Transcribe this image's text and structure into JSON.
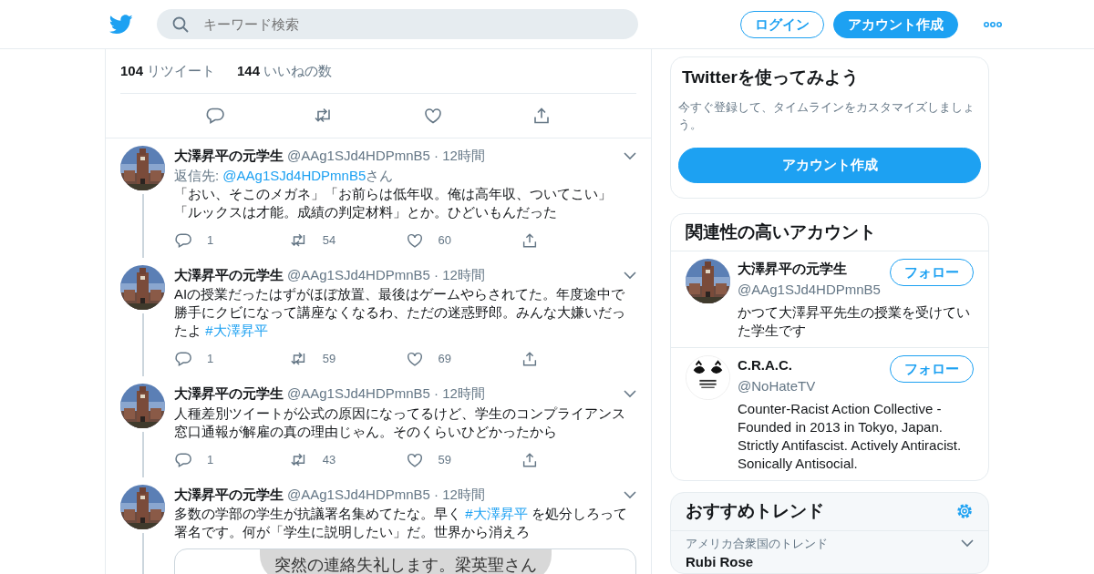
{
  "header": {
    "search": {
      "placeholder": "キーワード検索"
    },
    "login": "ログイン",
    "signup": "アカウント作成"
  },
  "main_tweet": {
    "stats": [
      {
        "count": "104",
        "label": "リツイート"
      },
      {
        "count": "144",
        "label": "いいねの数"
      }
    ]
  },
  "replies": [
    {
      "name": "大澤昇平の元学生",
      "handle": "@AAg1SJd4HDPmnB5",
      "time": "· 12時間",
      "reply_to": {
        "prefix": "返信先: ",
        "handle": "@AAg1SJd4HDPmnB5",
        "suffix": "さん"
      },
      "text": [
        {
          "kind": "plain",
          "t": "「おい、そこのメガネ」「お前らは低年収。俺は高年収、ついてこい」「ルックスは才能。成績の判定材料」とか。ひどいもんだった"
        }
      ],
      "replies": "1",
      "retweets": "54",
      "likes": "60"
    },
    {
      "name": "大澤昇平の元学生",
      "handle": "@AAg1SJd4HDPmnB5",
      "time": "· 12時間",
      "text": [
        {
          "kind": "plain",
          "t": "AIの授業だったはずがほぼ放置、最後はゲームやらされてた。年度途中で勝手にクビになって講座なくなるわ、ただの迷惑野郎。みんな大嫌いだったよ "
        },
        {
          "kind": "hashtag",
          "t": "#大澤昇平"
        }
      ],
      "replies": "1",
      "retweets": "59",
      "likes": "69"
    },
    {
      "name": "大澤昇平の元学生",
      "handle": "@AAg1SJd4HDPmnB5",
      "time": "· 12時間",
      "text": [
        {
          "kind": "plain",
          "t": "人種差別ツイートが公式の原因になってるけど、学生のコンプライアンス窓口通報が解雇の真の理由じゃん。そのくらいひどかったから"
        }
      ],
      "replies": "1",
      "retweets": "43",
      "likes": "59"
    },
    {
      "name": "大澤昇平の元学生",
      "handle": "@AAg1SJd4HDPmnB5",
      "time": "· 12時間",
      "text": [
        {
          "kind": "plain",
          "t": "多数の学部の学生が抗議署名集めてたな。早く "
        },
        {
          "kind": "hashtag",
          "t": "#大澤昇平"
        },
        {
          "kind": "plain",
          "t": " を処分しろって署名です。何が「学生に説明したい」だ。世界から消えろ"
        }
      ],
      "media": {
        "caption": "突然の連絡失礼します。梁英聖さん"
      }
    }
  ],
  "sidebar": {
    "signup_card": {
      "title": "Twitterを使ってみよう",
      "description": "今すぐ登録して、タイムラインをカスタマイズしましょう。",
      "button": "アカウント作成"
    },
    "accounts": {
      "title": "関連性の高いアカウント",
      "items": [
        {
          "name": "大澤昇平の元学生",
          "handle": "@AAg1SJd4HDPmnB5",
          "bio": "かつて大澤昇平先生の授業を受けていた学生です",
          "follow": "フォロー"
        },
        {
          "kind": "logo",
          "name": "C.R.A.C.",
          "handle": "@NoHateTV",
          "bio": "Counter-Racist Action Collective - Founded in 2013 in Tokyo, Japan. Strictly Antifascist. Actively Antiracist. Sonically Antisocial.",
          "follow": "フォロー"
        }
      ]
    },
    "trends": {
      "title": "おすすめトレンド",
      "items": [
        {
          "context": "アメリカ合衆国のトレンド",
          "name": "Rubi Rose"
        }
      ]
    }
  }
}
